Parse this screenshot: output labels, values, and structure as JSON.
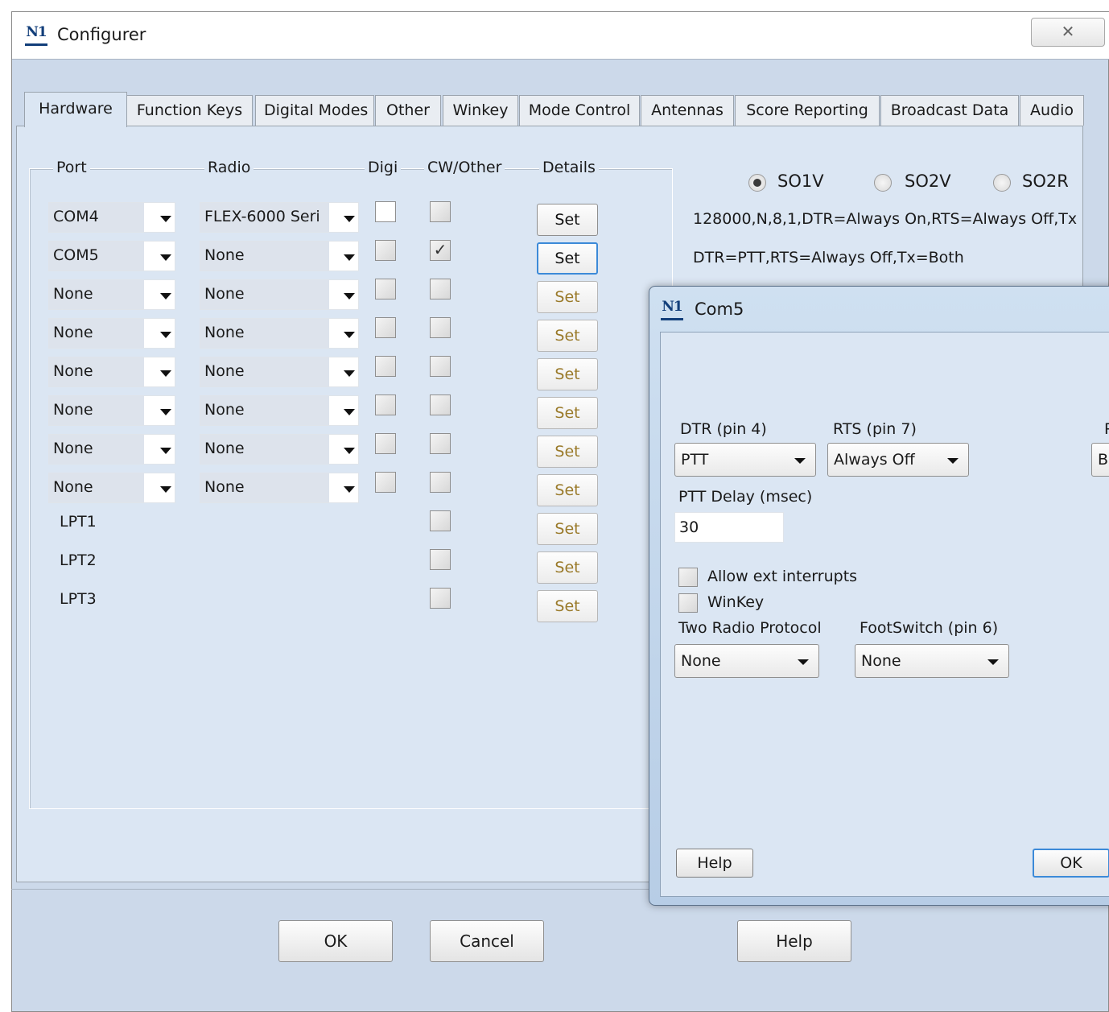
{
  "window": {
    "title": "Configurer",
    "logo_text": "N1",
    "close_glyph": "✕",
    "close_icon": "close-icon"
  },
  "tabs": [
    {
      "label": "Hardware",
      "active": true
    },
    {
      "label": "Function Keys"
    },
    {
      "label": "Digital Modes"
    },
    {
      "label": "Other"
    },
    {
      "label": "Winkey"
    },
    {
      "label": "Mode Control"
    },
    {
      "label": "Antennas"
    },
    {
      "label": "Score Reporting"
    },
    {
      "label": "Broadcast Data"
    },
    {
      "label": "Audio"
    }
  ],
  "hardware": {
    "headers": {
      "port": "Port",
      "radio": "Radio",
      "digi": "Digi",
      "cw_other": "CW/Other",
      "details": "Details"
    },
    "set_label": "Set",
    "rows": [
      {
        "port": "COM4",
        "radio": "FLEX-6000 Seri",
        "digi": false,
        "cw": false,
        "set_enabled": true,
        "config": "128000,N,8,1,DTR=Always On,RTS=Always Off,Tx"
      },
      {
        "port": "COM5",
        "radio": "None",
        "digi": false,
        "cw": true,
        "set_enabled": true,
        "config": "DTR=PTT,RTS=Always Off,Tx=Both"
      },
      {
        "port": "None",
        "radio": "None",
        "digi": false,
        "cw": false,
        "set_enabled": false
      },
      {
        "port": "None",
        "radio": "None",
        "digi": false,
        "cw": false,
        "set_enabled": false
      },
      {
        "port": "None",
        "radio": "None",
        "digi": false,
        "cw": false,
        "set_enabled": false
      },
      {
        "port": "None",
        "radio": "None",
        "digi": false,
        "cw": false,
        "set_enabled": false
      },
      {
        "port": "None",
        "radio": "None",
        "digi": false,
        "cw": false,
        "set_enabled": false
      },
      {
        "port": "None",
        "radio": "None",
        "digi": false,
        "cw": false,
        "set_enabled": false
      }
    ],
    "lpt_rows": [
      {
        "port": "LPT1",
        "cw": false
      },
      {
        "port": "LPT2",
        "cw": false
      },
      {
        "port": "LPT3",
        "cw": false
      }
    ],
    "so_mode": {
      "options": [
        "SO1V",
        "SO2V",
        "SO2R"
      ],
      "selected": "SO1V"
    }
  },
  "buttons": {
    "ok": "OK",
    "cancel": "Cancel",
    "help": "Help"
  },
  "dialog": {
    "title": "Com5",
    "logo_text": "N1",
    "dtr_label": "DTR (pin 4)",
    "dtr_value": "PTT",
    "rts_label": "RTS (pin 7)",
    "rts_value": "Always Off",
    "clipped_label": "P",
    "clipped_value": "B",
    "ptt_delay_label": "PTT Delay  (msec)",
    "ptt_delay_value": "30",
    "allow_ext_interrupts_label": "Allow ext interrupts",
    "allow_ext_interrupts": false,
    "winkey_label": "WinKey",
    "winkey": false,
    "two_radio_protocol_label": "Two Radio Protocol",
    "two_radio_protocol_value": "None",
    "footswitch_label": "FootSwitch (pin 6)",
    "footswitch_value": "None",
    "help_label": "Help",
    "ok_label": "OK"
  }
}
